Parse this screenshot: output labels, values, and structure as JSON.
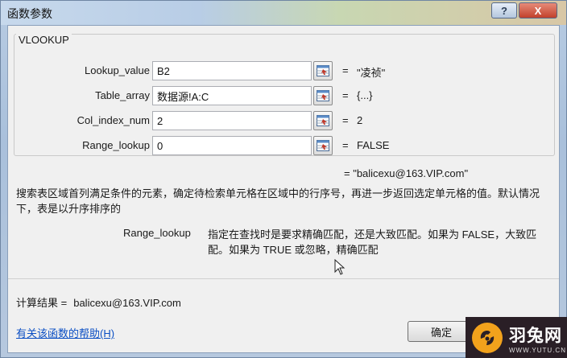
{
  "window": {
    "title": "函数参数",
    "help_glyph": "?",
    "close_glyph": "X"
  },
  "function_name": "VLOOKUP",
  "arguments": [
    {
      "label": "Lookup_value",
      "value": "B2",
      "eq": "=",
      "result": "\"凌祯\""
    },
    {
      "label": "Table_array",
      "value": "数据源!A:C",
      "eq": "=",
      "result": "{...}"
    },
    {
      "label": "Col_index_num",
      "value": "2",
      "eq": "=",
      "result": "2"
    },
    {
      "label": "Range_lookup",
      "value": "0",
      "eq": "=",
      "result": "FALSE"
    }
  ],
  "overall_result": "=  \"balicexu@163.VIP.com\"",
  "description": "搜索表区域首列满足条件的元素，确定待检索单元格在区域中的行序号，再进一步返回选定单元格的值。默认情况下，表是以升序排序的",
  "param_desc_label": "Range_lookup",
  "param_desc_text": "指定在查找时是要求精确匹配，还是大致匹配。如果为 FALSE，大致匹配。如果为 TRUE 或忽略，精确匹配",
  "calc_label": "计算结果 =",
  "calc_value": "balicexu@163.VIP.com",
  "help_link": "有关该函数的帮助(H)",
  "ok_label": "确定",
  "watermark": {
    "main": "羽兔网",
    "sub": "WWW.YUTU.CN"
  },
  "icons": {
    "collapse": "range-select-icon",
    "cursor": "mouse-cursor-icon",
    "logo": "yutu-logo-icon"
  }
}
